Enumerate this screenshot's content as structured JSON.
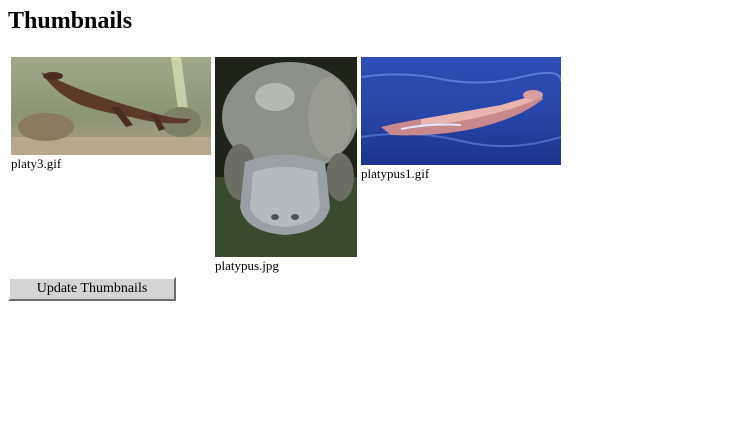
{
  "page": {
    "title": "Thumbnails"
  },
  "thumbnails": [
    {
      "filename": "platy3.gif",
      "icon": "platypus-swimming-underwater-image"
    },
    {
      "filename": "platypus.jpg",
      "icon": "platypus-head-closeup-image"
    },
    {
      "filename": "platypus1.gif",
      "icon": "platypus-swimming-surface-image"
    }
  ],
  "actions": {
    "update_label": "Update Thumbnails"
  },
  "colors": {
    "button_face": "#d4d4d4",
    "background": "#ffffff"
  }
}
